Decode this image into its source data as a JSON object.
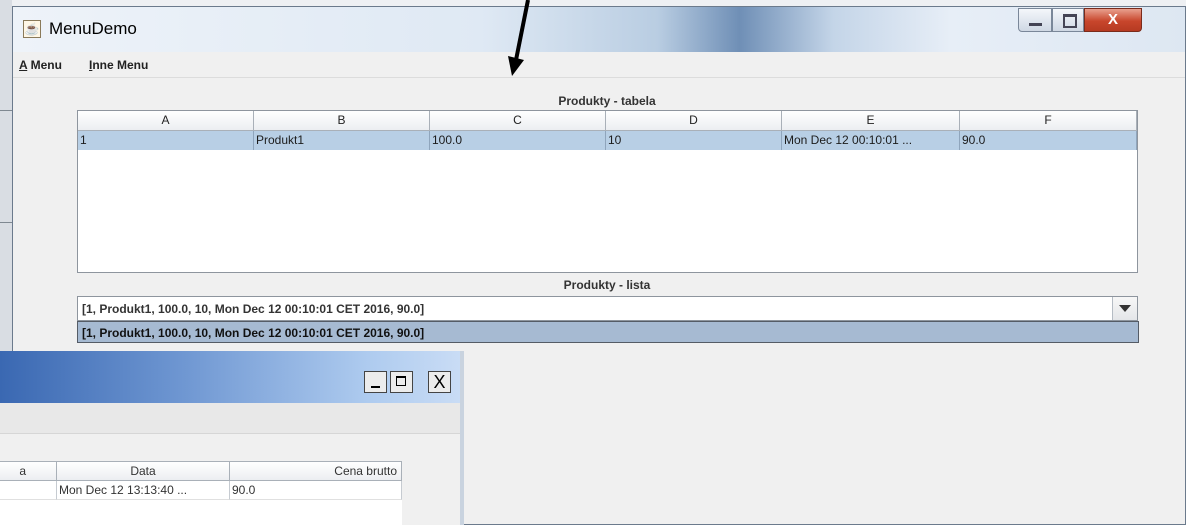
{
  "window": {
    "title": "MenuDemo",
    "controls": {
      "close": "X"
    }
  },
  "menu": {
    "a_menu": {
      "mnemonic": "A",
      "rest": " Menu"
    },
    "inne_menu": {
      "mnemonic": "I",
      "rest": "nne Menu"
    }
  },
  "table_section": {
    "title": "Produkty - tabela",
    "columns": [
      "A",
      "B",
      "C",
      "D",
      "E",
      "F"
    ],
    "rows": [
      [
        "1",
        "Produkt1",
        "100.0",
        "10",
        "Mon Dec 12 00:10:01 ...",
        "90.0"
      ]
    ]
  },
  "list_section": {
    "title": "Produkty - lista",
    "selected": "[1, Produkt1, 100.0, 10, Mon Dec 12 00:10:01 CET 2016, 90.0]",
    "options": [
      "[1, Produkt1, 100.0, 10, Mon Dec 12 00:10:01 CET 2016, 90.0]"
    ]
  },
  "second_window": {
    "close": "X",
    "columns": [
      "a",
      "Data",
      "Cena brutto"
    ],
    "rows": [
      [
        "",
        "Mon Dec 12 13:13:40 ...",
        "90.0"
      ]
    ]
  },
  "colors": {
    "selected_row": "#b8cfe5",
    "list_selection": "#a6bad2",
    "close_button": "#c8462c"
  }
}
